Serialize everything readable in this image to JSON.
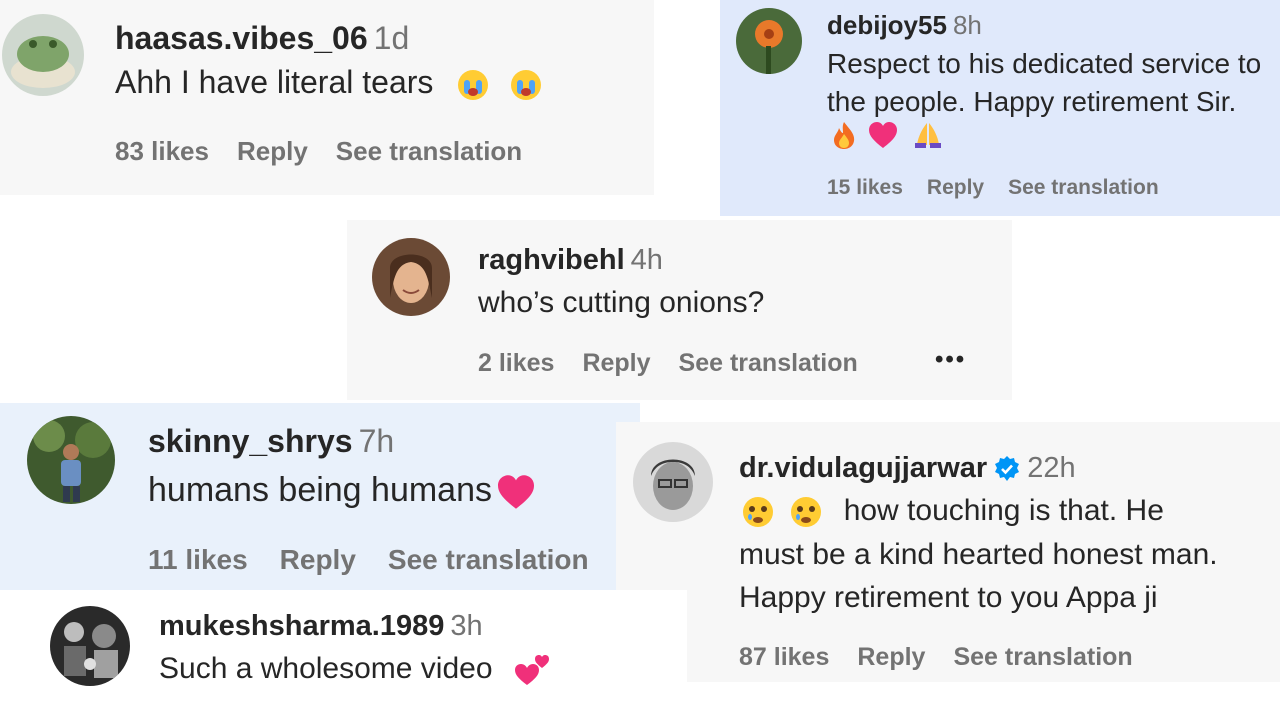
{
  "comments": [
    {
      "username": "haasas.vibes_06",
      "time": "1d",
      "text": "Ahh I have literal tears",
      "likes": "83 likes",
      "reply": "Reply",
      "translate": "See translation",
      "emoji": [
        "crying-face",
        "crying-face"
      ]
    },
    {
      "username": "debijoy55",
      "time": "8h",
      "text_lines": [
        "Respect to his dedicated service to",
        "the people. Happy retirement Sir."
      ],
      "likes": "15 likes",
      "reply": "Reply",
      "translate": "See translation",
      "emoji": [
        "fire",
        "heart",
        "folded-hands"
      ]
    },
    {
      "username": "raghvibehl",
      "time": "4h",
      "text": "who’s cutting onions?",
      "likes": "2 likes",
      "reply": "Reply",
      "translate": "See translation",
      "more": "•••"
    },
    {
      "username": "skinny_shrys",
      "time": "7h",
      "text": "humans being humans",
      "likes": "11 likes",
      "reply": "Reply",
      "translate": "See translation",
      "emoji": [
        "heart"
      ]
    },
    {
      "username": "dr.vidulagujjarwar",
      "time": "22h",
      "text_lines": [
        "how touching is that. He",
        "must be a kind hearted honest man.",
        "Happy retirement to you Appa ji"
      ],
      "likes": "87 likes",
      "reply": "Reply",
      "translate": "See translation",
      "emoji": [
        "sad-face",
        "sad-face"
      ],
      "verified": true
    },
    {
      "username": "mukeshsharma.1989",
      "time": "3h",
      "text": "Such a wholesome video",
      "emoji": [
        "two-hearts"
      ]
    }
  ],
  "colors": {
    "username": "#262626",
    "meta": "#737373",
    "verified": "#0095f6",
    "card_highlight_blue": "#e0e9fb",
    "card_gray": "#f7f7f7",
    "card_highlight_lightblue": "#e9f1fb"
  }
}
